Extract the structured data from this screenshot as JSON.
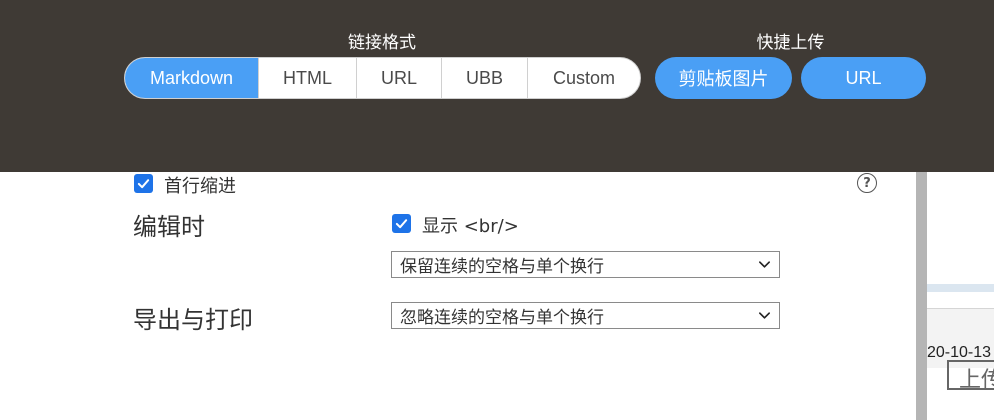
{
  "toolbar": {
    "link_format_title": "链接格式",
    "quick_upload_title": "快捷上传",
    "formats": [
      "Markdown",
      "HTML",
      "URL",
      "UBB",
      "Custom"
    ],
    "active_format": "Markdown",
    "clipboard_button": "剪贴板图片",
    "url_button": "URL",
    "accent_color": "#4a9ff5",
    "background_color": "#3f3a35"
  },
  "settings": {
    "first_line_indent": {
      "label": "首行缩进",
      "checked": true
    },
    "help_icon": "?",
    "editing": {
      "title": "编辑时",
      "show_br": {
        "label": "显示 <br/>",
        "checked": true
      },
      "whitespace_select": "保留连续的空格与单个换行"
    },
    "export": {
      "title": "导出与打印",
      "whitespace_select": "忽略连续的空格与单个换行"
    }
  },
  "background_window": {
    "date_fragment": "20-10-13",
    "upload_fragment": "上传"
  }
}
